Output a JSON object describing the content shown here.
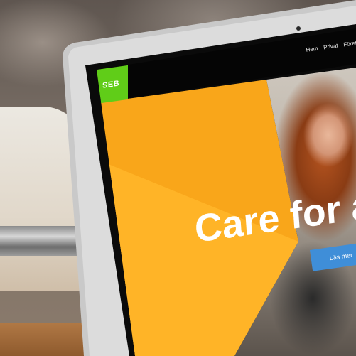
{
  "navigation": {
    "items": [
      {
        "label": "Hem"
      },
      {
        "label": "Privat"
      },
      {
        "label": "Företag"
      }
    ]
  },
  "brand": {
    "logo_text": "SEB",
    "accent_color": "#60cd18"
  },
  "hero": {
    "headline": "Care for am",
    "cta_label": "Läs mer",
    "primary_color": "#f9a61a",
    "button_color": "#3f8ed8"
  }
}
